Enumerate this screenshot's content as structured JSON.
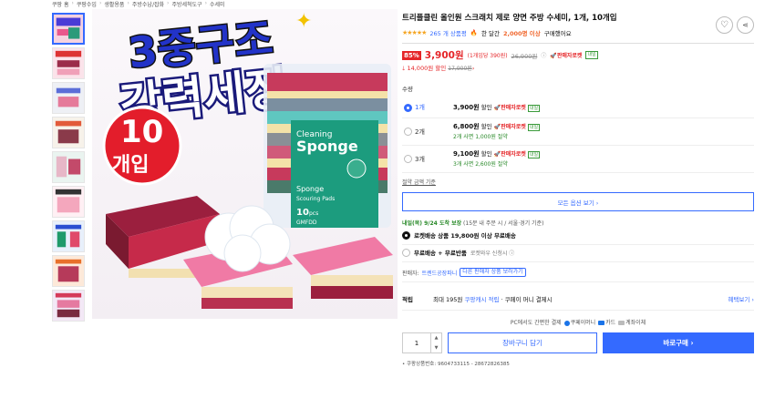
{
  "breadcrumb": [
    "쿠팡 홈",
    "쿠팡수입",
    "생활용품",
    "주방수납/잡화",
    "주방세척도구",
    "수세미"
  ],
  "colors": {
    "accent": "#346aff",
    "price_red": "#e52528",
    "green": "#2a8a2a"
  },
  "product": {
    "title": "트리플클린 올인원 스크래치 제로 양면 주방 수세미, 1개, 10개입",
    "rating_count": "265 개 상품평",
    "hot_text_pre": "한 달간",
    "hot_text_count": "2,000명 이상",
    "hot_text_post": "구매했어요",
    "discount_pct": "85%",
    "price": "3,900원",
    "unit_price": "(1개입당 390원)",
    "orig_price": "26,900원",
    "rocket": "판매자로켓",
    "badge": "내일",
    "coupon_discount": "14,000원 할인",
    "coupon_orig": "17,900원"
  },
  "image_text": {
    "headline1": "3중구조",
    "headline2": "강력세정",
    "count_badge_1": "10",
    "count_badge_2": "개입",
    "pack_1": "Cleaning",
    "pack_2": "Sponge",
    "pack_3": "Sponge",
    "pack_4": "Scouring Pads",
    "pack_5": "10",
    "pack_6": "pcs",
    "pack_7": "GMFDD"
  },
  "quantity_label": "수량",
  "options": [
    {
      "name": "1개",
      "price": "3,900원",
      "discount": "할인",
      "rocket": "판매자로켓",
      "badge": "내일",
      "sub": ""
    },
    {
      "name": "2개",
      "price": "6,800원",
      "discount": "할인",
      "rocket": "판매자로켓",
      "badge": "내일",
      "sub": "2개 사면 1,000원 절약"
    },
    {
      "name": "3개",
      "price": "9,100원",
      "discount": "할인",
      "rocket": "판매자로켓",
      "badge": "내일",
      "sub": "3개 사면 2,600원 절약"
    }
  ],
  "unit_basis": "절약 금액 기준",
  "all_options": "모든 옵션 보기 ›",
  "delivery": {
    "arrival": "내일(목) 9/24 도착 보장",
    "arrival_note": "(15분 내 주문 시 / 서울·경기 기준)",
    "opt1": "로켓배송 상품 19,800원 이상 무료배송",
    "opt2": "무료배송 + 무료반품",
    "opt2_note": "로켓와우 신청시 ⓘ"
  },
  "seller": {
    "label": "판매자:",
    "name": "트렌드공장파니",
    "button": "다른 판매자 상품 보러가기"
  },
  "points": {
    "label": "적립",
    "text_pre": "최대 195원",
    "link": "쿠팡캐시 적립",
    "text_post": "· 쿠페이 머니 결제시",
    "more": "혜택보기 ›"
  },
  "payment": {
    "text": "PC에서도 간편한 결제",
    "m1": "쿠페이머니",
    "m2": "카드",
    "m3": "계좌이체"
  },
  "cart": {
    "qty": "1",
    "cart_label": "장바구니 담기",
    "buy_label": "바로구매 ›"
  },
  "product_id": "• 쿠팡상품번호: 9604733115 - 28672826385"
}
